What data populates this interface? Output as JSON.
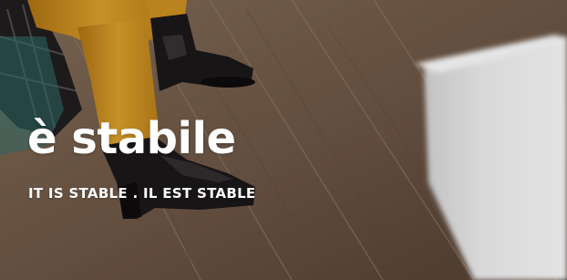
{
  "banner": {
    "headline": "è stabile",
    "subline": "IT IS STABLE . IL EST STABLE"
  },
  "colors": {
    "floor": "#6b5646",
    "mustard": "#c48a1e",
    "boot": "#1a1718",
    "text": "#ffffff"
  }
}
